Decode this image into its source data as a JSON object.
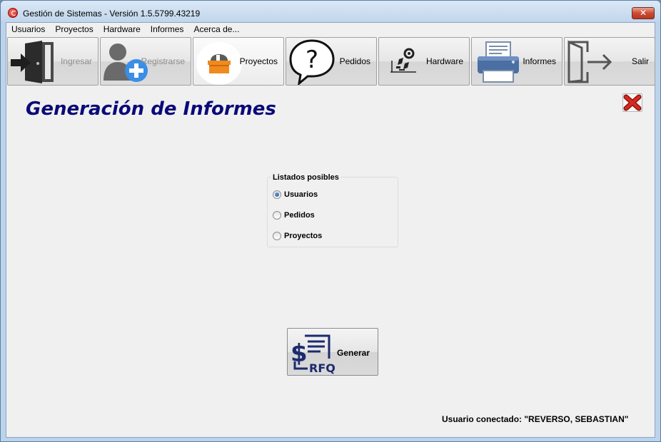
{
  "window": {
    "title": "Gestión de Sistemas - Versión 1.5.5799.43219",
    "close_glyph": "✕"
  },
  "menu": [
    {
      "label": "Usuarios"
    },
    {
      "label": "Proyectos"
    },
    {
      "label": "Hardware"
    },
    {
      "label": "Informes"
    },
    {
      "label": "Acerca de..."
    }
  ],
  "toolbar": [
    {
      "label": "Ingresar",
      "icon": "login-door-icon",
      "enabled": false
    },
    {
      "label": "Registrarse",
      "icon": "add-user-icon",
      "enabled": false
    },
    {
      "label": "Proyectos",
      "icon": "projects-box-icon",
      "enabled": true
    },
    {
      "label": "Pedidos",
      "icon": "question-bubble-icon",
      "enabled": true
    },
    {
      "label": "Hardware",
      "icon": "hardware-icon",
      "enabled": true
    },
    {
      "label": "Informes",
      "icon": "printer-icon",
      "enabled": true
    },
    {
      "label": "Salir",
      "icon": "exit-door-icon",
      "enabled": true
    }
  ],
  "page": {
    "title": "Generación de Informes"
  },
  "reports": {
    "legend": "Listados posibles",
    "options": [
      {
        "label": "Usuarios",
        "checked": true
      },
      {
        "label": "Pedidos",
        "checked": false
      },
      {
        "label": "Proyectos",
        "checked": false
      }
    ]
  },
  "generate": {
    "label": "Generar",
    "icon_text": "RFQ"
  },
  "status": {
    "text": "Usuario conectado:  \"REVERSO, SEBASTIAN\""
  },
  "colors": {
    "title": "#0a0a78",
    "accent_orange": "#f08a1c",
    "accent_blue": "#3a8ee6",
    "icon_navy": "#1c2a6e",
    "close_red": "#d9281e"
  }
}
